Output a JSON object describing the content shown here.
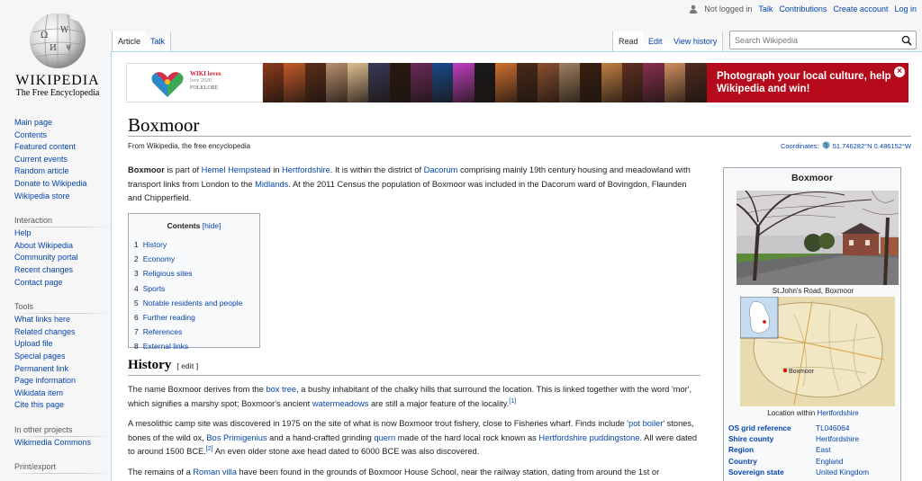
{
  "logo": {
    "wordmark": "WIKIPEDIA",
    "tagline": "The Free Encyclopedia"
  },
  "sidebar": {
    "main": [
      "Main page",
      "Contents",
      "Featured content",
      "Current events",
      "Random article",
      "Donate to Wikipedia",
      "Wikipedia store"
    ],
    "interaction_heading": "Interaction",
    "interaction": [
      "Help",
      "About Wikipedia",
      "Community portal",
      "Recent changes",
      "Contact page"
    ],
    "tools_heading": "Tools",
    "tools": [
      "What links here",
      "Related changes",
      "Upload file",
      "Special pages",
      "Permanent link",
      "Page information",
      "Wikidata item",
      "Cite this page"
    ],
    "projects_heading": "In other projects",
    "projects": [
      "Wikimedia Commons"
    ],
    "print_heading": "Print/export"
  },
  "personal": {
    "not_logged_in": "Not logged in",
    "talk": "Talk",
    "contributions": "Contributions",
    "create_account": "Create account",
    "login": "Log in"
  },
  "tabs": {
    "article": "Article",
    "talk": "Talk",
    "read": "Read",
    "edit": "Edit",
    "history": "View history"
  },
  "search": {
    "placeholder": "Search Wikipedia",
    "value": ""
  },
  "banner": {
    "logo_line1": "WIKI loves",
    "logo_line2": "love 2020",
    "logo_line3": "FOLKLORE",
    "message": "Photograph your local culture, help Wikipedia and win!",
    "close_symbol": "×",
    "strip_colors": [
      "#8a3a1c",
      "#c45a2a",
      "#5a2e1a",
      "#b89070",
      "#e0c090",
      "#3a3a5a",
      "#2a1a10",
      "#6a2a5a",
      "#1a4a8a",
      "#c040c0",
      "#1a1a1a",
      "#d07030",
      "#4a2a1a",
      "#8a5030",
      "#a08060",
      "#3a2010",
      "#c08040",
      "#603020",
      "#8a3050",
      "#d09060",
      "#502a20"
    ]
  },
  "article": {
    "title": "Boxmoor",
    "site_sub": "From Wikipedia, the free encyclopedia",
    "coords_label": "Coordinates:",
    "coords_value": "51.746282°N 0.486152°W",
    "intro": {
      "bold": "Boxmoor",
      "t1": " is part of ",
      "l1": "Hemel Hempstead",
      "t2": " in ",
      "l2": "Hertfordshire",
      "t3": ". It is within the district of ",
      "l3": "Dacorum",
      "t4": " comprising mainly 19th century housing and meadowland with transport links from London to the ",
      "l4": "Midlands",
      "t5": ". At the 2011 Census the population of Boxmoor was included in the Dacorum ward of Bovingdon, Flaunden and Chipperfield."
    },
    "toc": {
      "title": "Contents",
      "hide": "[hide]",
      "items": [
        {
          "num": "1",
          "label": "History"
        },
        {
          "num": "2",
          "label": "Economy"
        },
        {
          "num": "3",
          "label": "Religious sites"
        },
        {
          "num": "4",
          "label": "Sports"
        },
        {
          "num": "5",
          "label": "Notable residents and people"
        },
        {
          "num": "6",
          "label": "Further reading"
        },
        {
          "num": "7",
          "label": "References"
        },
        {
          "num": "8",
          "label": "External links"
        }
      ]
    },
    "history_heading": "History",
    "edit_section": "[ edit ]",
    "p1": {
      "t1": "The name Boxmoor derives from the ",
      "l1": "box tree",
      "t2": ", a bushy inhabitant of the chalky hills that surround the location. This is linked together with the word 'mor', which signifies a marshy spot; Boxmoor's ancient ",
      "l2": "watermeadows",
      "t3": " are still a major feature of the locality.",
      "ref1": "[1]"
    },
    "p2": {
      "t1": "A mesolithic camp site was discovered in 1975 on the site of what is now Boxmoor trout fishery, close to Fisheries wharf. Finds include '",
      "l1": "pot boiler",
      "t2": "' stones, bones of the wild ox, ",
      "l2": "Bos Primigenius",
      "t3": " and a hand-crafted grinding ",
      "l3": "quern",
      "t4": " made of the hard local rock known as ",
      "l4": "Hertfordshire puddingstone",
      "t5": ". All were dated to around 1500 BCE.",
      "ref2": "[2]",
      "t6": " An even older stone axe head dated to 6000 BCE was also discovered."
    },
    "p3": {
      "t1": "The remains of a ",
      "l1": "Roman villa",
      "t2": " have been found in the grounds of Boxmoor House School, near the railway station, dating from around the 1st or"
    }
  },
  "infobox": {
    "title": "Boxmoor",
    "image_caption": "St.John's Road, Boxmoor",
    "map_label": "Boxmoor",
    "map_caption_prefix": "Location within ",
    "map_caption_link": "Hertfordshire",
    "rows": [
      {
        "key": "OS grid reference",
        "value": "TL046064"
      },
      {
        "key": "Shire county",
        "value": "Hertfordshire"
      },
      {
        "key": "Region",
        "value": "East"
      },
      {
        "key": "Country",
        "value": "England"
      },
      {
        "key": "Sovereign state",
        "value": "United Kingdom"
      }
    ]
  }
}
